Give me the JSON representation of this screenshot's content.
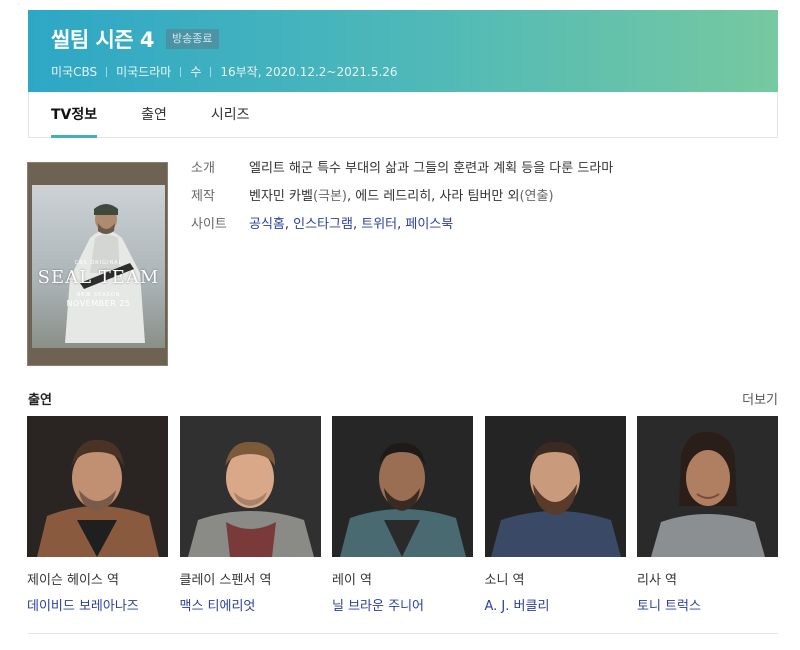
{
  "header": {
    "title": "씰팀 시즌 4",
    "status_badge": "방송종료",
    "meta": [
      "미국CBS",
      "미국드라마",
      "수",
      "16부작, 2020.12.2~2021.5.26"
    ],
    "colors": {
      "gradient_start": "#2ea7c6",
      "gradient_end": "#76c9a0"
    }
  },
  "tabs": [
    {
      "label": "TV정보",
      "active": true
    },
    {
      "label": "출연",
      "active": false
    },
    {
      "label": "시리즈",
      "active": false
    }
  ],
  "poster": {
    "small_top": "CBS ORIGINAL",
    "title": "SEAL TEAM",
    "sub1": "NEW SEASON",
    "sub2": "NOVEMBER 25"
  },
  "info": {
    "synopsis_label": "소개",
    "synopsis": "엘리트 해군 특수 부대의 삶과 그들의 훈련과 계획 등을 다룬 드라마",
    "production_label": "제작",
    "production_writer": "벤자민 카벨",
    "production_writer_role": "(극본)",
    "production_sep": ", ",
    "production_directors": "에드 레드리히, 사라 팀버만 외",
    "production_director_role": "(연출)",
    "site_label": "사이트",
    "sites": [
      "공식홈",
      "인스타그램",
      "트위터",
      "페이스북"
    ]
  },
  "cast_section": {
    "title": "출연",
    "more_label": "더보기",
    "members": [
      {
        "role": "제이슨 헤이스 역",
        "actor": "데이비드 보레아나즈",
        "icon": "portrait-jason"
      },
      {
        "role": "클레이 스펜서 역",
        "actor": "맥스 티에리엇",
        "icon": "portrait-clay"
      },
      {
        "role": "레이 역",
        "actor": "닐 브라운 주니어",
        "icon": "portrait-ray"
      },
      {
        "role": "소니 역",
        "actor": "A. J. 버클리",
        "icon": "portrait-sonny"
      },
      {
        "role": "리사 역",
        "actor": "토니 트럭스",
        "icon": "portrait-lisa"
      }
    ]
  }
}
